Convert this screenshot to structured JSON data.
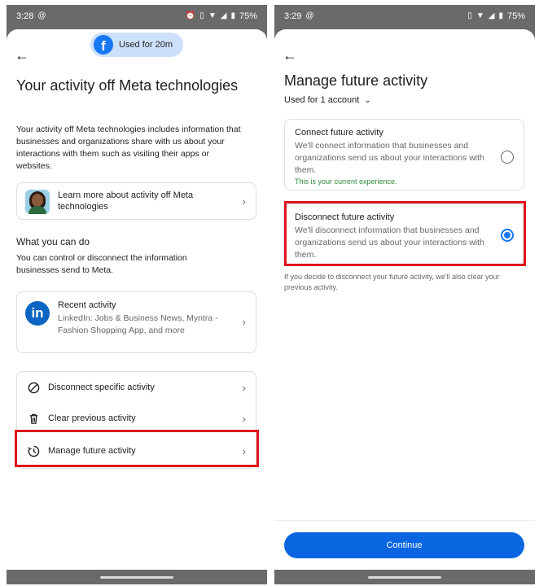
{
  "left": {
    "status": {
      "time": "3:28",
      "battery": "75%"
    },
    "usage_pill": "Used for 20m",
    "title": "Your activity off Meta technologies",
    "description": "Your activity off Meta technologies includes information that businesses and organizations share with us about your interactions with them such as visiting their apps or websites.",
    "learn_more": "Learn more about activity off Meta technologies",
    "section_title": "What you can do",
    "section_desc": "You can control or disconnect the information businesses send to Meta.",
    "recent": {
      "title": "Recent activity",
      "subtitle": "LinkedIn: Jobs & Business News, Myntra - Fashion Shopping App, and more"
    },
    "actions": [
      {
        "label": "Disconnect specific activity",
        "icon": "block-icon"
      },
      {
        "label": "Clear previous activity",
        "icon": "trash-icon"
      },
      {
        "label": "Manage future activity",
        "icon": "history-icon"
      }
    ]
  },
  "right": {
    "status": {
      "time": "3:29",
      "battery": "75%"
    },
    "title": "Manage future activity",
    "account_selector": "Used for 1 account",
    "options": [
      {
        "title": "Connect future activity",
        "desc": "We'll connect information that businesses and organizations send us about your interactions with them.",
        "note": "This is your current experience.",
        "selected": false
      },
      {
        "title": "Disconnect future activity",
        "desc": "We'll disconnect information that businesses and organizations send us about your interactions with them.",
        "selected": true
      }
    ],
    "footnote": "If you decide to disconnect your future activity, we'll also clear your previous activity.",
    "continue_label": "Continue"
  },
  "colors": {
    "accent": "#1877f2",
    "highlight": "#e0151c",
    "linkedin": "#0a66c2",
    "success_note": "#2e8b3a"
  }
}
